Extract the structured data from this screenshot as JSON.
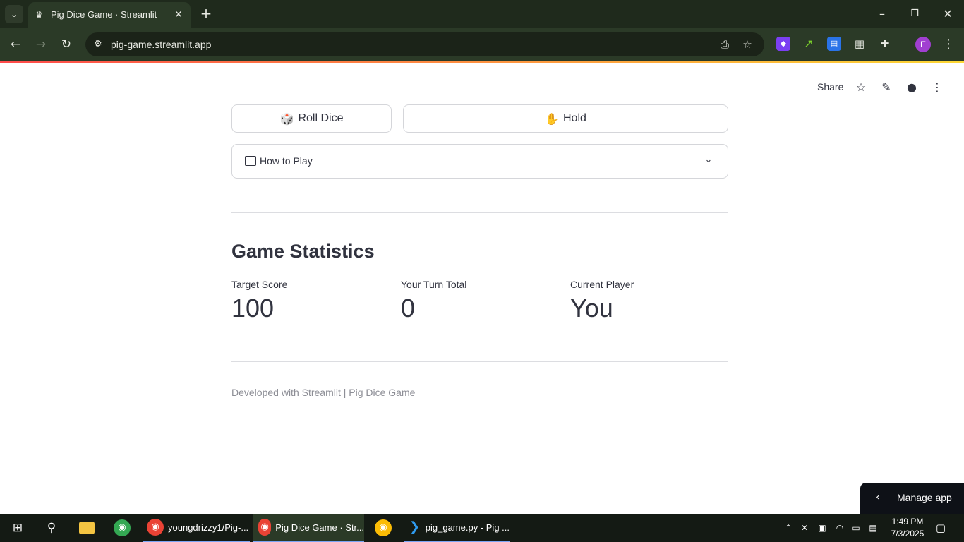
{
  "browser": {
    "tab_title": "Pig Dice Game · Streamlit",
    "url": "pig-game.streamlit.app"
  },
  "app_header": {
    "share_label": "Share"
  },
  "controls": {
    "roll_emoji": "🎲",
    "roll_label": "Roll Dice",
    "hold_emoji": "✋",
    "hold_label": "Hold"
  },
  "expander": {
    "label": "How to Play"
  },
  "stats": {
    "title": "Game Statistics",
    "metrics": [
      {
        "label": "Target Score",
        "value": "100"
      },
      {
        "label": "Your Turn Total",
        "value": "0"
      },
      {
        "label": "Current Player",
        "value": "You"
      }
    ]
  },
  "footer": {
    "text": "Developed with Streamlit | Pig Dice Game"
  },
  "manage_app": {
    "label": "Manage app"
  },
  "taskbar": {
    "items": [
      {
        "label": "youngdrizzy1/Pig-..."
      },
      {
        "label": "Pig Dice Game · Str..."
      },
      {
        "label": "pig_game.py - Pig ..."
      }
    ],
    "time": "1:49 PM",
    "date": "7/3/2025"
  },
  "colors": {
    "streamlit_text": "#31333f",
    "accent_red": "#ff4b4b",
    "accent_yellow": "#fdd835",
    "chrome_frame": "#1f2a1c",
    "chrome_toolbar": "#2b3a27"
  }
}
